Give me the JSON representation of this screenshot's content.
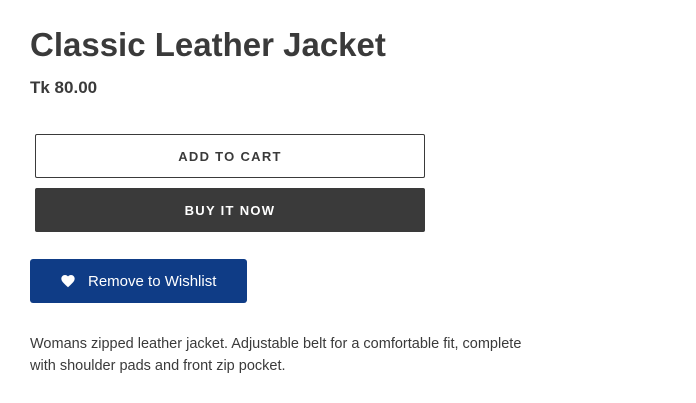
{
  "product": {
    "title": "Classic Leather Jacket",
    "price": "Tk 80.00",
    "description": "Womans zipped leather jacket. Adjustable belt for a comfortable fit, complete with shoulder pads and front zip pocket."
  },
  "actions": {
    "add_to_cart_label": "ADD TO CART",
    "buy_now_label": "BUY IT NOW",
    "wishlist_label": "Remove to Wishlist",
    "wishlist_icon": "heart-icon"
  },
  "colors": {
    "text": "#3a3a3a",
    "buy_button_bg": "#3a3a3a",
    "wishlist_button_bg": "#0f3c86"
  }
}
